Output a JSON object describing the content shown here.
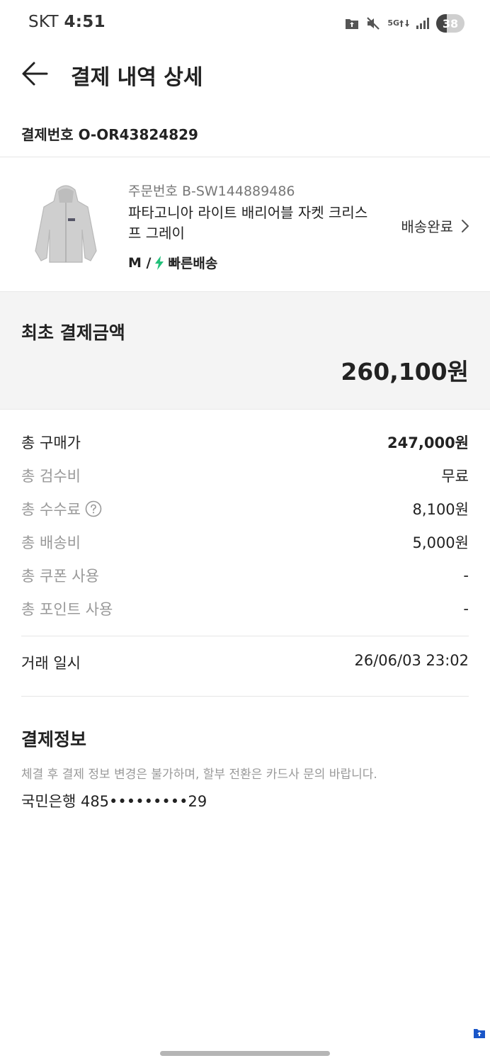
{
  "status_bar": {
    "carrier": "SKT",
    "time": "4:51",
    "network": "5G",
    "battery": "38",
    "battery_level_percent": 38,
    "icons": [
      "folder-upload-icon",
      "mute-icon",
      "5g-data-icon",
      "signal-icon",
      "battery-icon"
    ]
  },
  "header": {
    "back_icon": "arrow-left-icon",
    "title": "결제 내역 상세"
  },
  "payment_number": "결제번호 O-OR43824829",
  "order": {
    "order_number": "주문번호 B-SW144889486",
    "product_name": "파타고니아 라이트 배리어블 자켓 크리스프 그레이",
    "size": "M /",
    "shipping_type": "빠른배송",
    "shipping_icon": "lightning-bolt-icon",
    "status": "배송완료",
    "status_icon": "chevron-right-icon"
  },
  "total": {
    "label": "최초 결제금액",
    "value": "260,100원"
  },
  "breakdown": [
    {
      "label": "총 구매가",
      "value": "247,000원"
    },
    {
      "label": "총 검수비",
      "value": "무료"
    },
    {
      "label": "총 수수료",
      "value": "8,100원",
      "icon": "question-circle-icon"
    },
    {
      "label": "총 배송비",
      "value": "5,000원"
    },
    {
      "label": "총 쿠폰 사용",
      "value": "-"
    },
    {
      "label": "총 포인트 사용",
      "value": "-"
    }
  ],
  "transaction": {
    "label": "거래 일시",
    "value": "26/06/03 23:02"
  },
  "payment_info": {
    "title": "결제정보",
    "notice": "체결 후 결제 정보 변경은 불가하며, 할부 전환은 카드사 문의 바랍니다.",
    "card": "국민은행 485•••••••••29"
  },
  "colors": {
    "accent_green": "#22c07a",
    "summary_bg": "#f4f4f4",
    "muted_text": "#999999",
    "floating_icon": "#1a56c8"
  }
}
